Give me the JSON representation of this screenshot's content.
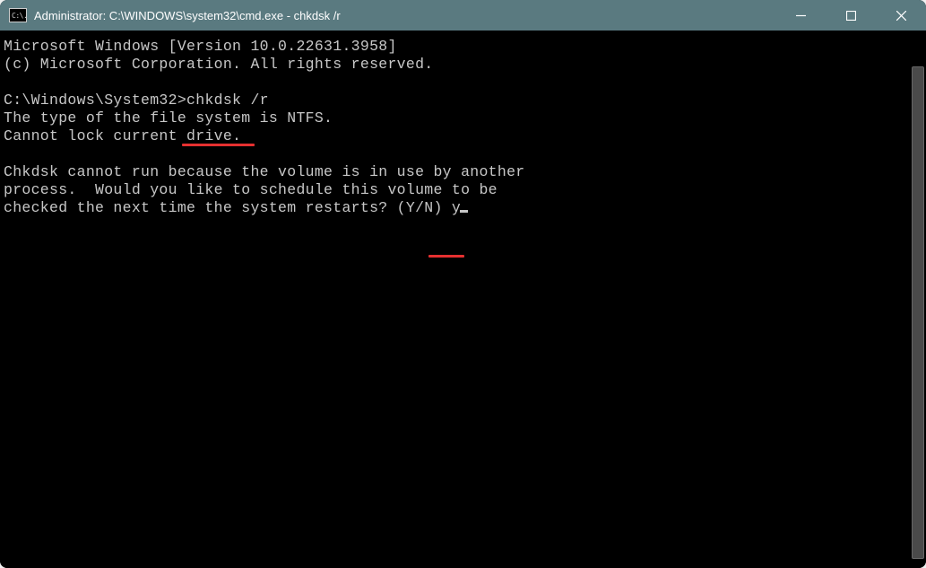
{
  "window": {
    "icon_text": "C:\\.",
    "title": "Administrator: C:\\WINDOWS\\system32\\cmd.exe - chkdsk  /r"
  },
  "console": {
    "line1": "Microsoft Windows [Version 10.0.22631.3958]",
    "line2": "(c) Microsoft Corporation. All rights reserved.",
    "blank1": "",
    "prompt_prefix": "C:\\Windows\\System32>",
    "command": "chkdsk /r",
    "line4": "The type of the file system is NTFS.",
    "line5": "Cannot lock current drive.",
    "blank2": "",
    "line6": "Chkdsk cannot run because the volume is in use by another",
    "line7": "process.  Would you like to schedule this volume to be",
    "line8_prefix": "checked the next time the system restarts? (Y/N) ",
    "response": "y"
  }
}
